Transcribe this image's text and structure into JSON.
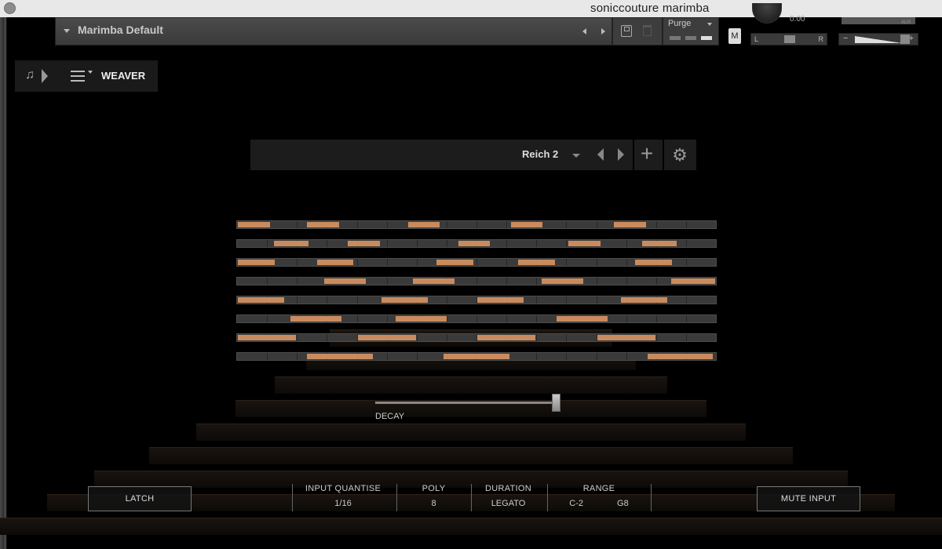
{
  "window": {
    "title": "soniccouture marimba"
  },
  "header": {
    "preset_name": "Marimba Default",
    "purge_label": "Purge",
    "m_label": "M",
    "tune_value": "0.00",
    "pan_left": "L",
    "pan_right": "R",
    "aux_label": "AUX",
    "vol_minus": "−",
    "vol_plus": "+"
  },
  "tab": {
    "label": "WEAVER"
  },
  "pattern": {
    "name": "Reich 2",
    "add_symbol": "+",
    "gear_symbol": "⚙"
  },
  "sequencer": {
    "active_color": "#c98b5e",
    "rows": [
      {
        "cells": [
          [
            0,
            0.07
          ],
          [
            0.145,
            0.215
          ],
          [
            0.355,
            0.425
          ],
          [
            0.57,
            0.64
          ],
          [
            0.785,
            0.855
          ]
        ]
      },
      {
        "cells": [
          [
            0.075,
            0.15
          ],
          [
            0.23,
            0.3
          ],
          [
            0.46,
            0.53
          ],
          [
            0.69,
            0.76
          ],
          [
            0.845,
            0.92
          ]
        ]
      },
      {
        "cells": [
          [
            0,
            0.08
          ],
          [
            0.165,
            0.245
          ],
          [
            0.415,
            0.495
          ],
          [
            0.585,
            0.665
          ],
          [
            0.83,
            0.91
          ]
        ]
      },
      {
        "cells": [
          [
            0.18,
            0.27
          ],
          [
            0.365,
            0.455
          ],
          [
            0.635,
            0.725
          ],
          [
            0.905,
            1.0
          ]
        ]
      },
      {
        "cells": [
          [
            0,
            0.1
          ],
          [
            0.3,
            0.4
          ],
          [
            0.5,
            0.6
          ],
          [
            0.8,
            0.9
          ]
        ]
      },
      {
        "cells": [
          [
            0.11,
            0.22
          ],
          [
            0.33,
            0.44
          ],
          [
            0.665,
            0.775
          ]
        ]
      },
      {
        "cells": [
          [
            0,
            0.125
          ],
          [
            0.25,
            0.375
          ],
          [
            0.5,
            0.625
          ],
          [
            0.75,
            0.875
          ]
        ]
      },
      {
        "cells": [
          [
            0.145,
            0.285
          ],
          [
            0.43,
            0.57
          ],
          [
            0.855,
            0.995
          ]
        ]
      }
    ]
  },
  "decay": {
    "label": "DECAY",
    "level": 0.98
  },
  "bottom": {
    "latch_label": "LATCH",
    "mute_label": "MUTE INPUT",
    "input_quantise": {
      "label": "INPUT QUANTISE",
      "value": "1/16"
    },
    "poly": {
      "label": "POLY",
      "value": "8"
    },
    "duration": {
      "label": "DURATION",
      "value": "LEGATO"
    },
    "range": {
      "label": "RANGE",
      "low": "C-2",
      "high": "G8"
    }
  }
}
